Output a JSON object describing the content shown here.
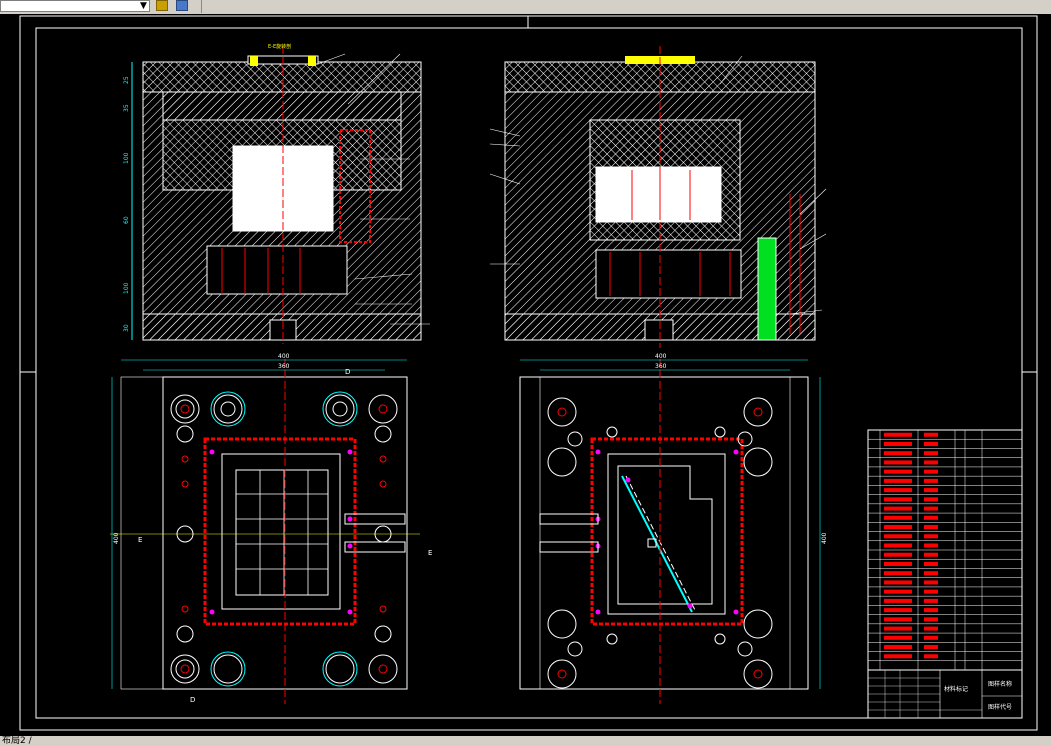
{
  "toolbar": {
    "layer_value": "",
    "icons": [
      "layer-arrow-icon",
      "layer-tool-icon",
      "layer-stack-icon"
    ]
  },
  "layout_tab": {
    "label": "布局2 /"
  },
  "drawing": {
    "section_label": "E-E旋转剖",
    "views": {
      "fixed_plan": {
        "dim_overall_w": "400",
        "dim_inner_w": "360",
        "dim_overall_h": "400",
        "section_marks": [
          "E",
          "E"
        ],
        "d_marks": [
          "D",
          "D"
        ]
      },
      "moving_plan": {
        "dim_overall_w": "400",
        "dim_inner_w": "360",
        "dim_overall_h": "400"
      },
      "front_section": {
        "vertical_dims": [
          "25",
          "35",
          "100",
          "60",
          "100",
          "30"
        ]
      }
    },
    "title_block": {
      "material_label": "材料标记",
      "name_label": "图样名称",
      "code_label": "图样代号"
    },
    "colors": {
      "line_white": "#ffffff",
      "line_red": "#ff0000",
      "line_cyan": "#00ffff",
      "line_yellow": "#ffff00",
      "line_green": "#00ff00",
      "line_magenta": "#ff00ff",
      "background": "#000000"
    }
  }
}
